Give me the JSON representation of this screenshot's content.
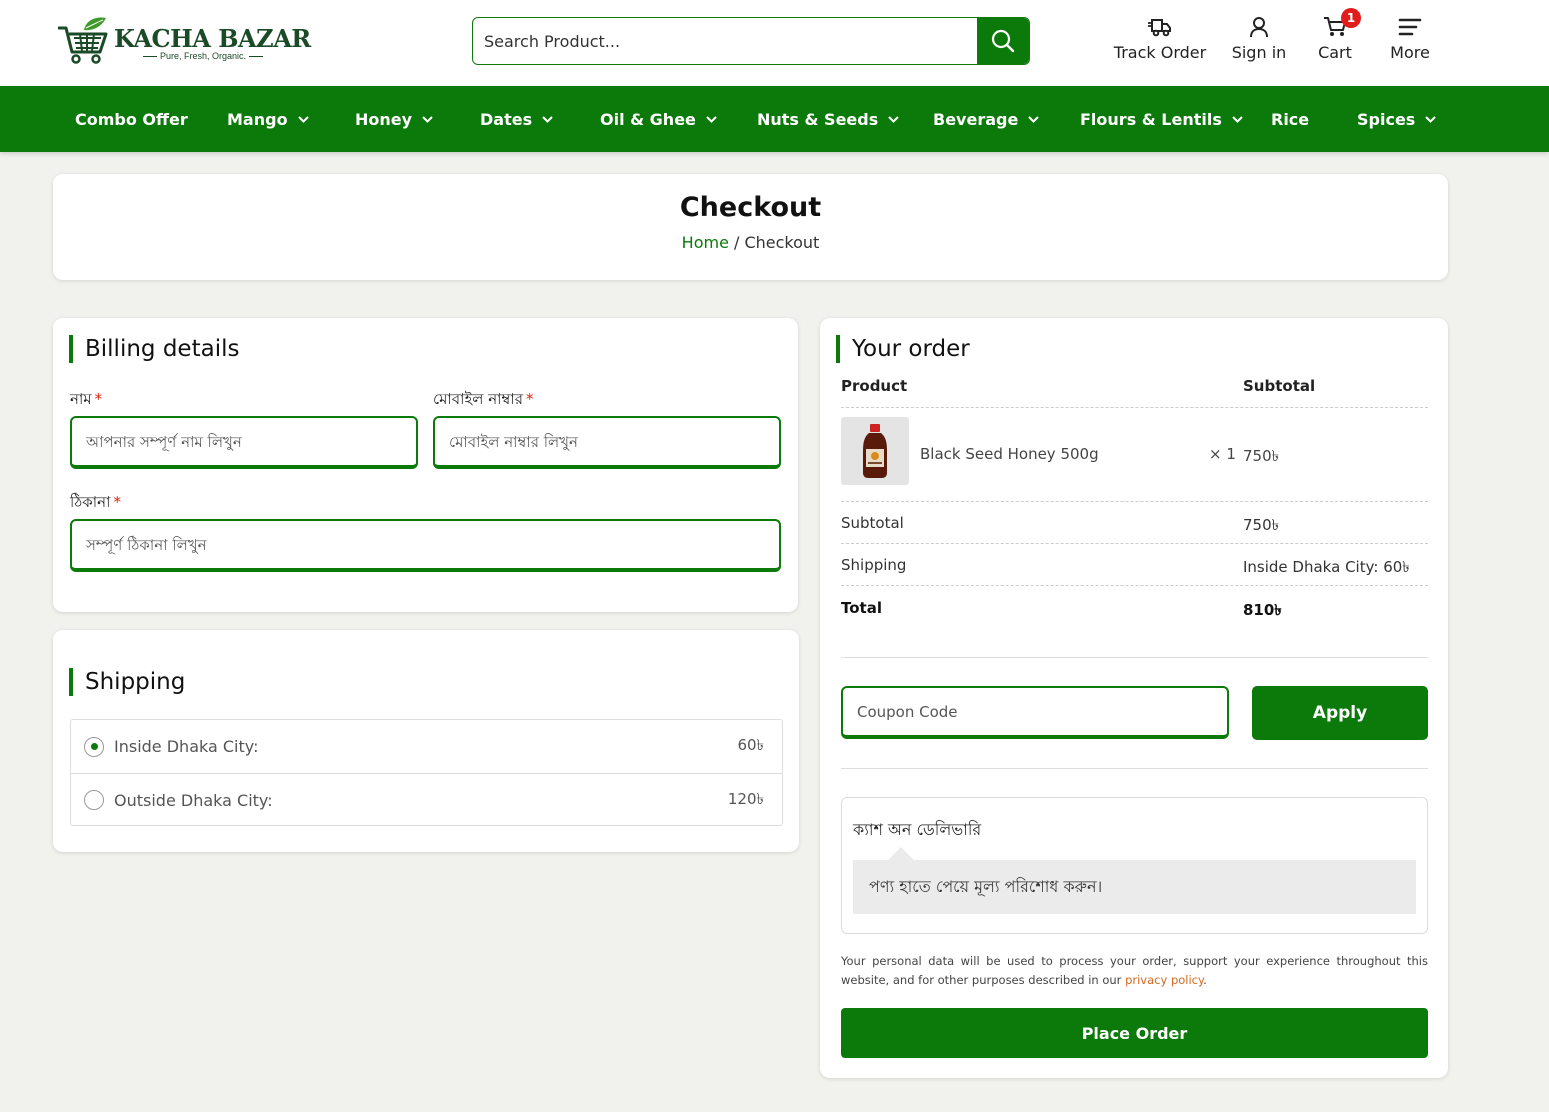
{
  "brand": {
    "name": "KACHA BAZAR",
    "tagline": "Pure, Fresh, Organic."
  },
  "search": {
    "placeholder": "Search Product..."
  },
  "header_actions": {
    "track_order": "Track Order",
    "sign_in": "Sign in",
    "cart": "Cart",
    "cart_count": "1",
    "more": "More"
  },
  "nav": {
    "items": [
      {
        "label": "Combo Offer",
        "has_dropdown": false
      },
      {
        "label": "Mango",
        "has_dropdown": true
      },
      {
        "label": "Honey",
        "has_dropdown": true
      },
      {
        "label": "Dates",
        "has_dropdown": true
      },
      {
        "label": "Oil & Ghee",
        "has_dropdown": true
      },
      {
        "label": "Nuts & Seeds",
        "has_dropdown": true
      },
      {
        "label": "Beverage",
        "has_dropdown": true
      },
      {
        "label": "Flours & Lentils",
        "has_dropdown": true
      },
      {
        "label": "Rice",
        "has_dropdown": false
      },
      {
        "label": "Spices",
        "has_dropdown": true
      }
    ]
  },
  "page": {
    "title": "Checkout",
    "breadcrumb": {
      "home": "Home",
      "separator": " / ",
      "current": "Checkout"
    }
  },
  "billing": {
    "heading": "Billing details",
    "name_label": "নাম",
    "name_placeholder": "আপনার সম্পূর্ণ নাম লিখুন",
    "mobile_label": "মোবাইল নাম্বার",
    "mobile_placeholder": "মোবাইল নাম্বার লিখুন",
    "address_label": "ঠিকানা",
    "address_placeholder": "সম্পূর্ণ ঠিকানা লিখুন",
    "required_mark": "*"
  },
  "shipping": {
    "heading": "Shipping",
    "options": [
      {
        "label": "Inside Dhaka City:",
        "price": "60৳",
        "selected": true
      },
      {
        "label": "Outside Dhaka City:",
        "price": "120৳",
        "selected": false
      }
    ]
  },
  "order": {
    "heading": "Your order",
    "col_product": "Product",
    "col_subtotal": "Subtotal",
    "items": [
      {
        "name": "Black Seed Honey 500g",
        "qty": "× 1",
        "subtotal": "750৳"
      }
    ],
    "subtotal_label": "Subtotal",
    "subtotal_value": "750৳",
    "shipping_label": "Shipping",
    "shipping_value": "Inside Dhaka City: 60৳",
    "total_label": "Total",
    "total_value": "810৳",
    "coupon_placeholder": "Coupon Code",
    "apply_label": "Apply",
    "payment_method": "ক্যাশ অন ডেলিভারি",
    "payment_desc": "পণ্য হাতে পেয়ে মূল্য পরিশোধ করুন।",
    "privacy_text": "Your personal data will be used to process your order, support your experience throughout this website, and for other purposes described in our ",
    "privacy_link": "privacy policy",
    "privacy_end": ".",
    "place_order": "Place Order"
  },
  "colors": {
    "primary": "#0b7a0b",
    "required": "#dd2211",
    "badge": "#e21b1b",
    "link": "#d2691e"
  }
}
